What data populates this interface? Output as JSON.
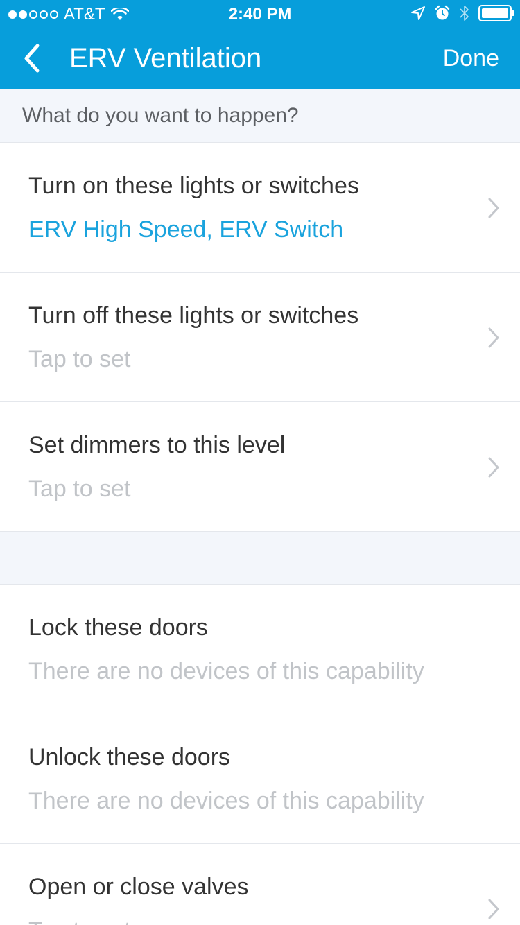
{
  "status_bar": {
    "carrier": "AT&T",
    "time": "2:40 PM",
    "signal_filled": 2,
    "signal_total": 5,
    "icons": [
      "wifi-icon",
      "location-icon",
      "alarm-icon",
      "bluetooth-icon",
      "battery-icon"
    ],
    "battery_level": 1.0
  },
  "nav": {
    "back_icon": "chevron-left-icon",
    "title": "ERV Ventilation",
    "done_label": "Done"
  },
  "section": {
    "header": "What do you want to happen?"
  },
  "rows": [
    {
      "title": "Turn on these lights or switches",
      "subtitle": "ERV High Speed, ERV Switch",
      "subtitle_style": "value",
      "has_chevron": true
    },
    {
      "title": "Turn off these lights or switches",
      "subtitle": "Tap to set",
      "subtitle_style": "placeholder",
      "has_chevron": true
    },
    {
      "title": "Set dimmers to this level",
      "subtitle": "Tap to set",
      "subtitle_style": "placeholder",
      "has_chevron": true
    },
    {
      "title": "Lock these doors",
      "subtitle": "There are no devices of this capability",
      "subtitle_style": "placeholder",
      "has_chevron": false
    },
    {
      "title": "Unlock these doors",
      "subtitle": "There are no devices of this capability",
      "subtitle_style": "placeholder",
      "has_chevron": false
    },
    {
      "title": "Open or close valves",
      "subtitle": "Tap to set",
      "subtitle_style": "placeholder",
      "has_chevron": true
    }
  ],
  "colors": {
    "nav_background": "#079edb",
    "accent": "#1aa3dd",
    "placeholder": "#c1c4c8",
    "section_background": "#f3f6fb"
  }
}
